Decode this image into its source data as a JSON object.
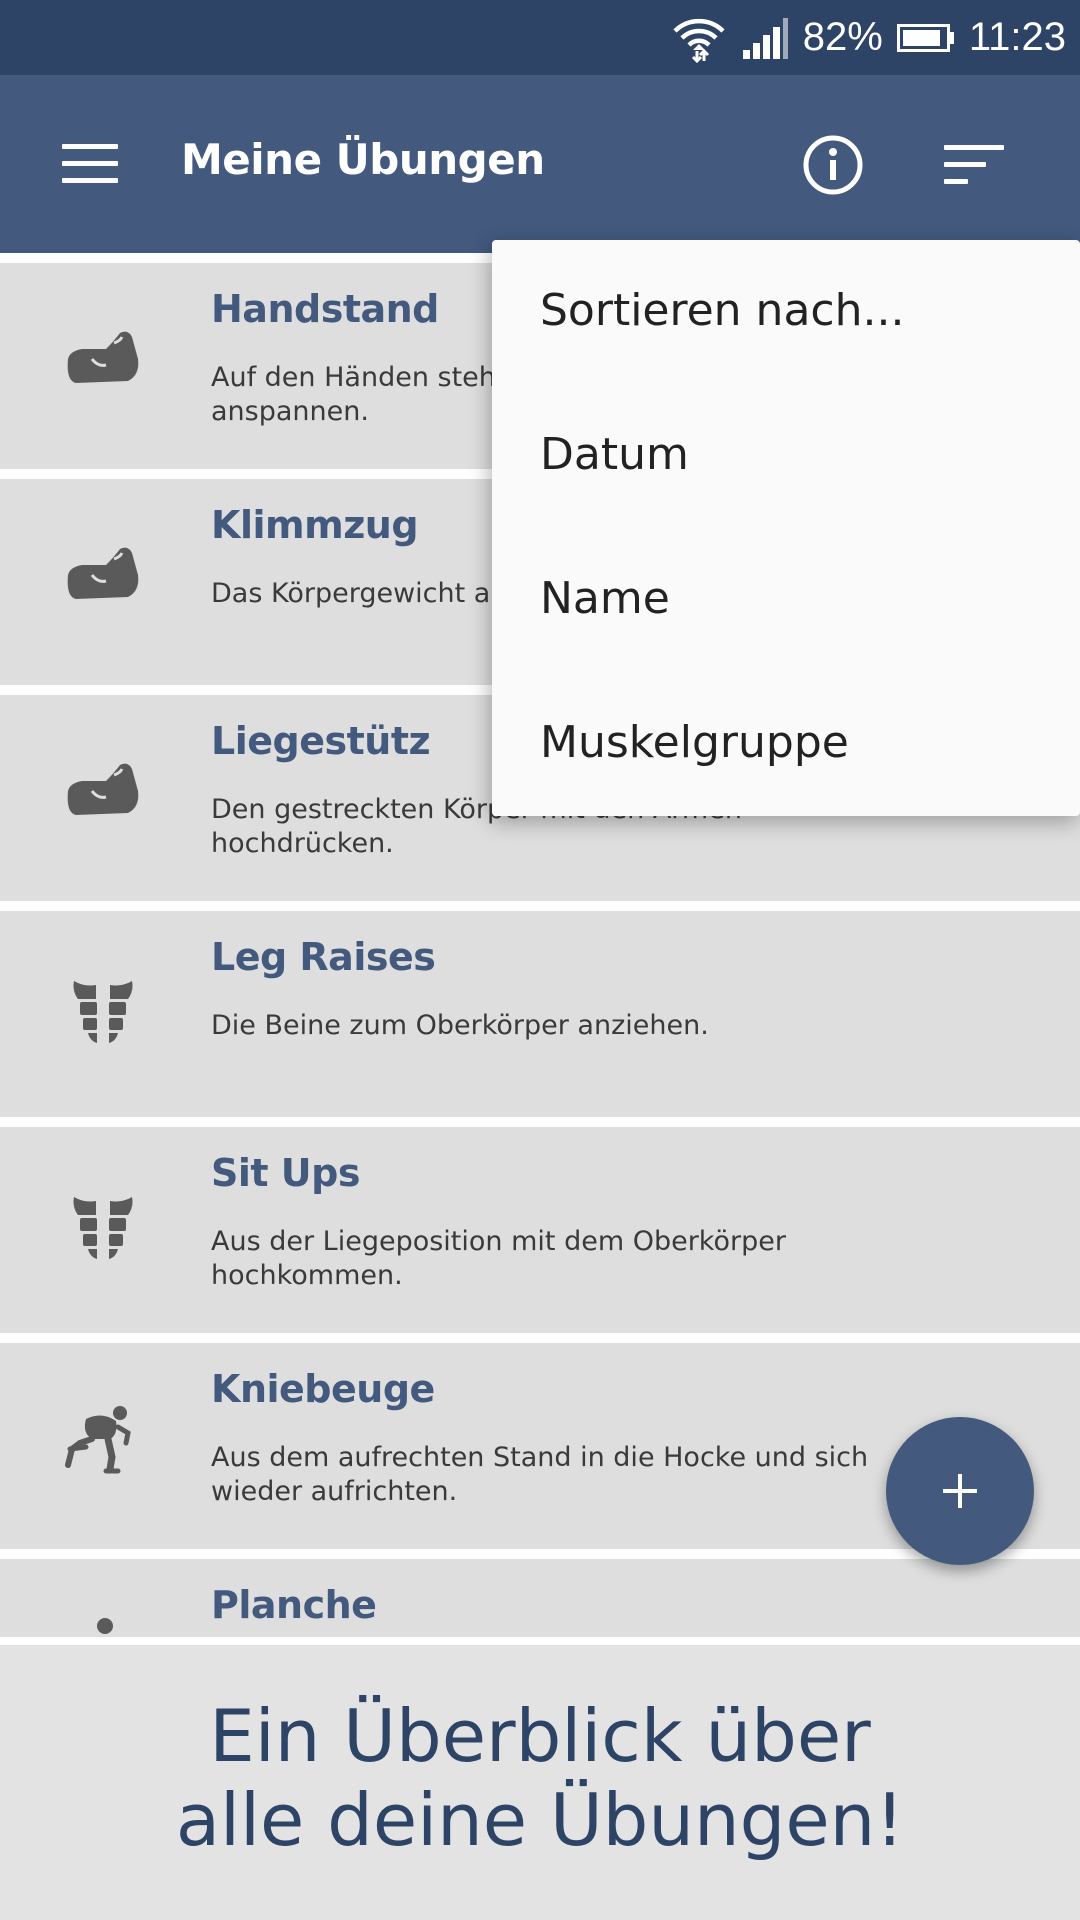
{
  "status_bar": {
    "battery": "82%",
    "time": "11:23",
    "icons": [
      "wifi-icon",
      "signal-icon",
      "battery-icon"
    ]
  },
  "app_bar": {
    "title": "Meine Übungen",
    "icons": [
      "menu-icon",
      "info-icon",
      "sort-icon"
    ]
  },
  "exercises": [
    {
      "title": "Handstand",
      "description": "Auf den Händen stehen und den Körper anspannen.",
      "icon": "arm-muscle-icon"
    },
    {
      "title": "Klimmzug",
      "description": "Das Körpergewicht an einer Stange hochziehen.",
      "icon": "arm-muscle-icon"
    },
    {
      "title": "Liegestütz",
      "description": "Den gestreckten Körper mit den Armen hochdrücken.",
      "icon": "arm-muscle-icon"
    },
    {
      "title": "Leg Raises",
      "description": "Die Beine zum Oberkörper anziehen.",
      "icon": "abs-icon"
    },
    {
      "title": "Sit Ups",
      "description": "Aus der Liegeposition mit dem Oberkörper hochkommen.",
      "icon": "abs-icon"
    },
    {
      "title": "Kniebeuge",
      "description": "Aus dem aufrechten Stand in die Hocke und sich wieder aufrichten.",
      "icon": "squat-icon"
    },
    {
      "title": "Planche",
      "description": "",
      "icon": "planche-icon"
    }
  ],
  "sort_menu": {
    "header": "Sortieren nach...",
    "options": [
      "Datum",
      "Name",
      "Muskelgruppe"
    ]
  },
  "fab": {
    "icon": "plus-icon"
  },
  "banner": {
    "line1": "Ein Überblick über",
    "line2": "alle deine Übungen!"
  },
  "colors": {
    "primary": "#43597e",
    "primary_dark": "#2e4466",
    "list_background": "#dedede"
  }
}
